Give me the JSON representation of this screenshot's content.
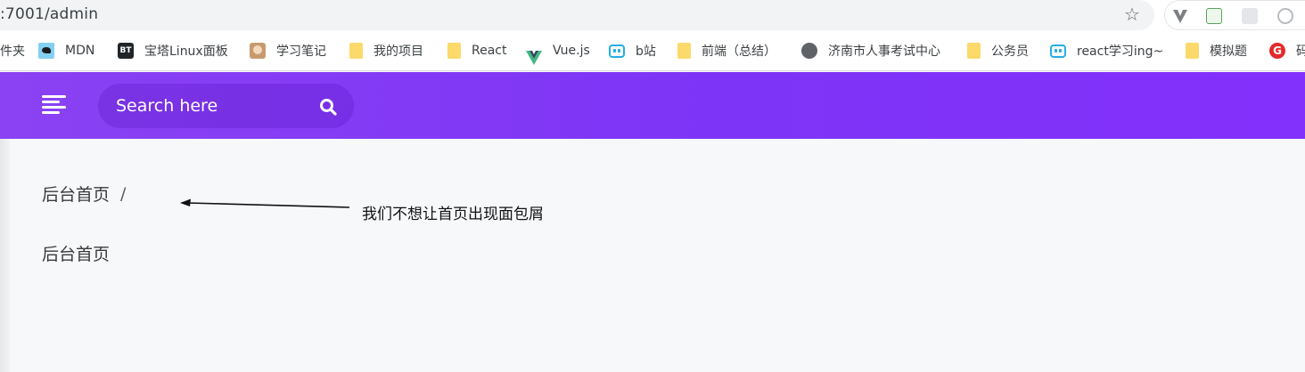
{
  "browser": {
    "address": ":7001/admin",
    "bookmarks": [
      {
        "label": "件夹",
        "icon": "folder-icon"
      },
      {
        "label": "MDN",
        "icon": "mdn-icon"
      },
      {
        "label": "宝塔Linux面板",
        "icon": "bt-icon",
        "badge": "BT"
      },
      {
        "label": "学习笔记",
        "icon": "avatar-icon"
      },
      {
        "label": "我的项目",
        "icon": "folder-icon"
      },
      {
        "label": "React",
        "icon": "folder-icon"
      },
      {
        "label": "Vue.js",
        "icon": "vue-icon"
      },
      {
        "label": "b站",
        "icon": "bilibili-icon"
      },
      {
        "label": "前端（总结）",
        "icon": "folder-icon"
      },
      {
        "label": "济南市人事考试中心",
        "icon": "globe-icon"
      },
      {
        "label": "公务员",
        "icon": "folder-icon"
      },
      {
        "label": "react学习ing~",
        "icon": "bilibili-icon"
      },
      {
        "label": "模拟题",
        "icon": "folder-icon"
      },
      {
        "label": "码",
        "icon": "red-g-icon",
        "badge": "G"
      }
    ]
  },
  "header": {
    "search_placeholder": "Search here",
    "accent_color": "#8236f7"
  },
  "breadcrumb": {
    "home": "后台首页",
    "separator": "/"
  },
  "annotation": {
    "text": "我们不想让首页出现面包屑"
  },
  "page": {
    "title": "后台首页"
  }
}
